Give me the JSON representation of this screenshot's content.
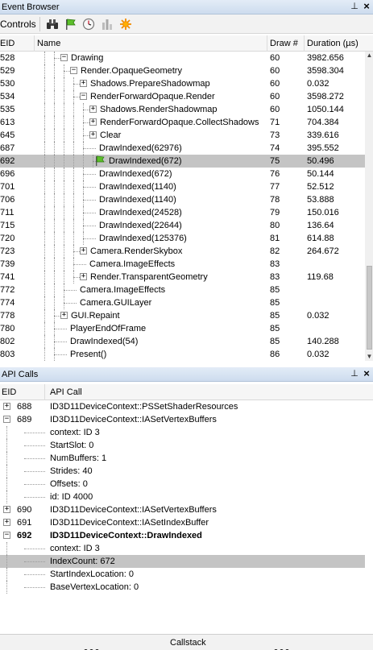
{
  "event_browser": {
    "title": "Event Browser",
    "pin": "⊥",
    "close": "×",
    "controls_label": "Controls",
    "toolbar_icons": [
      "binoculars-icon",
      "green-flag-icon",
      "clock-icon",
      "bar-chart-icon",
      "settings-sun-icon"
    ],
    "columns": {
      "eid": "EID",
      "name": "Name",
      "draw": "Draw #",
      "duration": "Duration (µs)"
    },
    "rows": [
      {
        "eid": "528",
        "name": "Drawing",
        "draw": "60",
        "duration": "3982.656",
        "level": 2,
        "toggle": "−"
      },
      {
        "eid": "529",
        "name": "Render.OpaqueGeometry",
        "draw": "60",
        "duration": "3598.304",
        "level": 3,
        "toggle": "−"
      },
      {
        "eid": "530",
        "name": "Shadows.PrepareShadowmap",
        "draw": "60",
        "duration": "0.032",
        "level": 4,
        "toggle": "+"
      },
      {
        "eid": "534",
        "name": "RenderForwardOpaque.Render",
        "draw": "60",
        "duration": "3598.272",
        "level": 4,
        "toggle": "−"
      },
      {
        "eid": "535",
        "name": "Shadows.RenderShadowmap",
        "draw": "60",
        "duration": "1050.144",
        "level": 5,
        "toggle": "+"
      },
      {
        "eid": "613",
        "name": "RenderForwardOpaque.CollectShadows",
        "draw": "71",
        "duration": "704.384",
        "level": 5,
        "toggle": "+"
      },
      {
        "eid": "645",
        "name": "Clear",
        "draw": "73",
        "duration": "339.616",
        "level": 5,
        "toggle": "+"
      },
      {
        "eid": "687",
        "name": "DrawIndexed(62976)",
        "draw": "74",
        "duration": "395.552",
        "level": 5,
        "toggle": ""
      },
      {
        "eid": "692",
        "name": "DrawIndexed(672)",
        "draw": "75",
        "duration": "50.496",
        "level": 6,
        "toggle": "",
        "selected": true,
        "flag": true
      },
      {
        "eid": "696",
        "name": "DrawIndexed(672)",
        "draw": "76",
        "duration": "50.144",
        "level": 5,
        "toggle": ""
      },
      {
        "eid": "701",
        "name": "DrawIndexed(1140)",
        "draw": "77",
        "duration": "52.512",
        "level": 5,
        "toggle": ""
      },
      {
        "eid": "706",
        "name": "DrawIndexed(1140)",
        "draw": "78",
        "duration": "53.888",
        "level": 5,
        "toggle": ""
      },
      {
        "eid": "711",
        "name": "DrawIndexed(24528)",
        "draw": "79",
        "duration": "150.016",
        "level": 5,
        "toggle": ""
      },
      {
        "eid": "715",
        "name": "DrawIndexed(22644)",
        "draw": "80",
        "duration": "136.64",
        "level": 5,
        "toggle": ""
      },
      {
        "eid": "720",
        "name": "DrawIndexed(125376)",
        "draw": "81",
        "duration": "614.88",
        "level": 5,
        "toggle": ""
      },
      {
        "eid": "723",
        "name": "Camera.RenderSkybox",
        "draw": "82",
        "duration": "264.672",
        "level": 4,
        "toggle": "+"
      },
      {
        "eid": "739",
        "name": "Camera.ImageEffects",
        "draw": "83",
        "duration": "",
        "level": 4,
        "toggle": ""
      },
      {
        "eid": "741",
        "name": "Render.TransparentGeometry",
        "draw": "83",
        "duration": "119.68",
        "level": 4,
        "toggle": "+"
      },
      {
        "eid": "772",
        "name": "Camera.ImageEffects",
        "draw": "85",
        "duration": "",
        "level": 3,
        "toggle": ""
      },
      {
        "eid": "774",
        "name": "Camera.GUILayer",
        "draw": "85",
        "duration": "",
        "level": 3,
        "toggle": ""
      },
      {
        "eid": "778",
        "name": "GUI.Repaint",
        "draw": "85",
        "duration": "0.032",
        "level": 2,
        "toggle": "+"
      },
      {
        "eid": "780",
        "name": "PlayerEndOfFrame",
        "draw": "85",
        "duration": "",
        "level": 2,
        "toggle": ""
      },
      {
        "eid": "802",
        "name": "DrawIndexed(54)",
        "draw": "85",
        "duration": "140.288",
        "level": 2,
        "toggle": ""
      },
      {
        "eid": "803",
        "name": "Present()",
        "draw": "86",
        "duration": "0.032",
        "level": 2,
        "toggle": ""
      }
    ]
  },
  "api_calls": {
    "title": "API Calls",
    "pin": "⊥",
    "close": "×",
    "columns": {
      "eid": "EID",
      "call": "API Call"
    },
    "rows": [
      {
        "eid": "688",
        "call": "ID3D11DeviceContext::PSSetShaderResources",
        "level": 0,
        "toggle": "+",
        "bold": false,
        "selected": false
      },
      {
        "eid": "689",
        "call": "ID3D11DeviceContext::IASetVertexBuffers",
        "level": 0,
        "toggle": "−",
        "bold": false,
        "selected": false
      },
      {
        "eid": "",
        "call": "context: ID 3",
        "level": 1,
        "toggle": "",
        "bold": false,
        "selected": false
      },
      {
        "eid": "",
        "call": "StartSlot: 0",
        "level": 1,
        "toggle": "",
        "bold": false,
        "selected": false
      },
      {
        "eid": "",
        "call": "NumBuffers: 1",
        "level": 1,
        "toggle": "",
        "bold": false,
        "selected": false
      },
      {
        "eid": "",
        "call": "Strides: 40",
        "level": 1,
        "toggle": "",
        "bold": false,
        "selected": false
      },
      {
        "eid": "",
        "call": "Offsets: 0",
        "level": 1,
        "toggle": "",
        "bold": false,
        "selected": false
      },
      {
        "eid": "",
        "call": "id: ID 4000",
        "level": 1,
        "toggle": "",
        "bold": false,
        "selected": false
      },
      {
        "eid": "690",
        "call": "ID3D11DeviceContext::IASetVertexBuffers",
        "level": 0,
        "toggle": "+",
        "bold": false,
        "selected": false
      },
      {
        "eid": "691",
        "call": "ID3D11DeviceContext::IASetIndexBuffer",
        "level": 0,
        "toggle": "+",
        "bold": false,
        "selected": false
      },
      {
        "eid": "692",
        "call": "ID3D11DeviceContext::DrawIndexed",
        "level": 0,
        "toggle": "−",
        "bold": true,
        "selected": false
      },
      {
        "eid": "",
        "call": "context: ID 3",
        "level": 1,
        "toggle": "",
        "bold": false,
        "selected": false
      },
      {
        "eid": "",
        "call": "IndexCount: 672",
        "level": 1,
        "toggle": "",
        "bold": false,
        "selected": true
      },
      {
        "eid": "",
        "call": "StartIndexLocation: 0",
        "level": 1,
        "toggle": "",
        "bold": false,
        "selected": false
      },
      {
        "eid": "",
        "call": "BaseVertexLocation: 0",
        "level": 1,
        "toggle": "",
        "bold": false,
        "selected": false
      }
    ]
  },
  "bottom": {
    "callstack_label": "Callstack"
  }
}
